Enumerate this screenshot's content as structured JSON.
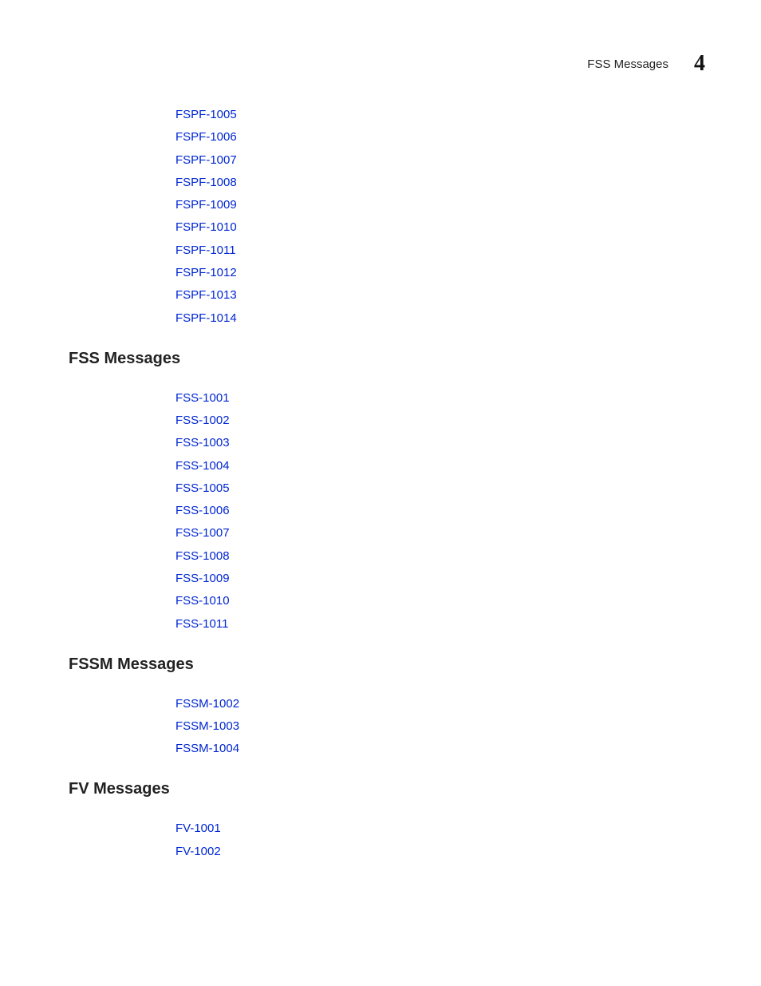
{
  "header": {
    "title": "FSS Messages",
    "chapter": "4"
  },
  "sections": [
    {
      "heading": null,
      "links": [
        "FSPF-1005",
        "FSPF-1006",
        "FSPF-1007",
        "FSPF-1008",
        "FSPF-1009",
        "FSPF-1010",
        "FSPF-1011",
        "FSPF-1012",
        "FSPF-1013",
        "FSPF-1014"
      ]
    },
    {
      "heading": "FSS Messages",
      "links": [
        "FSS-1001",
        "FSS-1002",
        "FSS-1003",
        "FSS-1004",
        "FSS-1005",
        "FSS-1006",
        "FSS-1007",
        "FSS-1008",
        "FSS-1009",
        "FSS-1010",
        "FSS-1011"
      ]
    },
    {
      "heading": "FSSM Messages",
      "links": [
        "FSSM-1002",
        "FSSM-1003",
        "FSSM-1004"
      ]
    },
    {
      "heading": "FV Messages",
      "links": [
        "FV-1001",
        "FV-1002"
      ]
    }
  ]
}
